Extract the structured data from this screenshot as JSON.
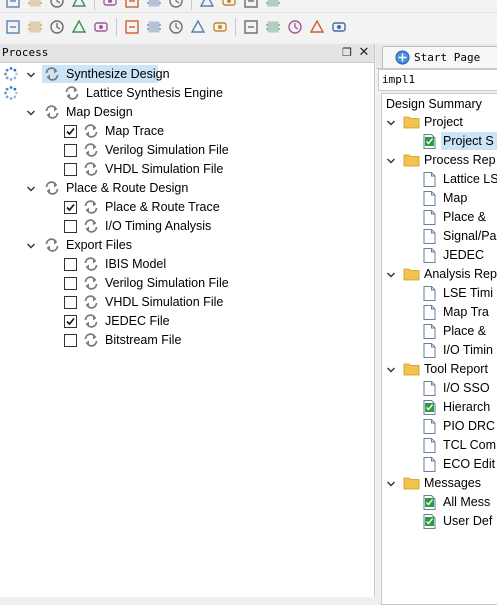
{
  "toolbar_top": {
    "icons": [
      "new-file-icon",
      "open-folder-icon",
      "save-icon",
      "save-all-icon",
      "print-icon",
      "undo-icon",
      "cut-icon",
      "copy-icon",
      "paste-icon",
      "find-icon",
      "settings-icon",
      "chart-icon"
    ]
  },
  "toolbar_main": {
    "icons": [
      "pencil-icon",
      "chip-icon",
      "chip-add-icon",
      "layers-icon",
      "filter-icon",
      "tool-icon",
      "grid-icon",
      "board-icon",
      "matrix-icon",
      "zoom-icon",
      "device-icon",
      "scan-icon",
      "swap-icon",
      "text-icon",
      "bolt-icon"
    ]
  },
  "process_panel": {
    "title": "Process",
    "float_label": "❐",
    "close_label": "✕",
    "items": [
      {
        "label": "Synthesize Design",
        "level": 0,
        "expanded": true,
        "selected": true,
        "status": "running"
      },
      {
        "label": "Lattice Synthesis Engine",
        "level": 1,
        "status": "running"
      },
      {
        "label": "Map Design",
        "level": 0,
        "expanded": true
      },
      {
        "label": "Map Trace",
        "level": 1,
        "checked": true
      },
      {
        "label": "Verilog Simulation File",
        "level": 1,
        "checked": false
      },
      {
        "label": "VHDL Simulation File",
        "level": 1,
        "checked": false
      },
      {
        "label": "Place & Route Design",
        "level": 0,
        "expanded": true
      },
      {
        "label": "Place & Route Trace",
        "level": 1,
        "checked": true
      },
      {
        "label": "I/O Timing Analysis",
        "level": 1,
        "checked": false
      },
      {
        "label": "Export Files",
        "level": 0,
        "expanded": true
      },
      {
        "label": "IBIS Model",
        "level": 1,
        "checked": false
      },
      {
        "label": "Verilog Simulation File",
        "level": 1,
        "checked": false
      },
      {
        "label": "VHDL Simulation File",
        "level": 1,
        "checked": false
      },
      {
        "label": "JEDEC File",
        "level": 1,
        "checked": true
      },
      {
        "label": "Bitstream File",
        "level": 1,
        "checked": false
      }
    ]
  },
  "editor": {
    "start_tab_label": "Start Page",
    "impl_label": "impl1",
    "summary_title": "Design Summary",
    "tree": [
      {
        "label": "Project",
        "type": "folder"
      },
      {
        "label": "Project S",
        "type": "check-doc",
        "selected": true
      },
      {
        "label": "Process Rep",
        "type": "folder"
      },
      {
        "label": "Lattice LS",
        "type": "doc"
      },
      {
        "label": "Map",
        "type": "doc"
      },
      {
        "label": "Place &",
        "type": "doc"
      },
      {
        "label": "Signal/Pa",
        "type": "doc"
      },
      {
        "label": "JEDEC",
        "type": "doc"
      },
      {
        "label": "Analysis Rep",
        "type": "folder"
      },
      {
        "label": "LSE Timi",
        "type": "doc"
      },
      {
        "label": "Map Tra",
        "type": "doc"
      },
      {
        "label": "Place &",
        "type": "doc"
      },
      {
        "label": "I/O Timin",
        "type": "doc"
      },
      {
        "label": "Tool Report",
        "type": "folder"
      },
      {
        "label": "I/O SSO",
        "type": "doc"
      },
      {
        "label": "Hierarch",
        "type": "check-doc"
      },
      {
        "label": "PIO DRC",
        "type": "doc"
      },
      {
        "label": "TCL Com",
        "type": "doc"
      },
      {
        "label": "ECO Edit",
        "type": "doc"
      },
      {
        "label": "Messages",
        "type": "folder"
      },
      {
        "label": "All Mess",
        "type": "check-doc"
      },
      {
        "label": "User Def",
        "type": "check-doc"
      }
    ]
  },
  "colors": {
    "selection": "#cce4f7",
    "arrow_icon": "#7a7a7a",
    "spinner": "#1a5fb4",
    "folder": "#f3c44d",
    "check_green": "#2e9d42"
  }
}
